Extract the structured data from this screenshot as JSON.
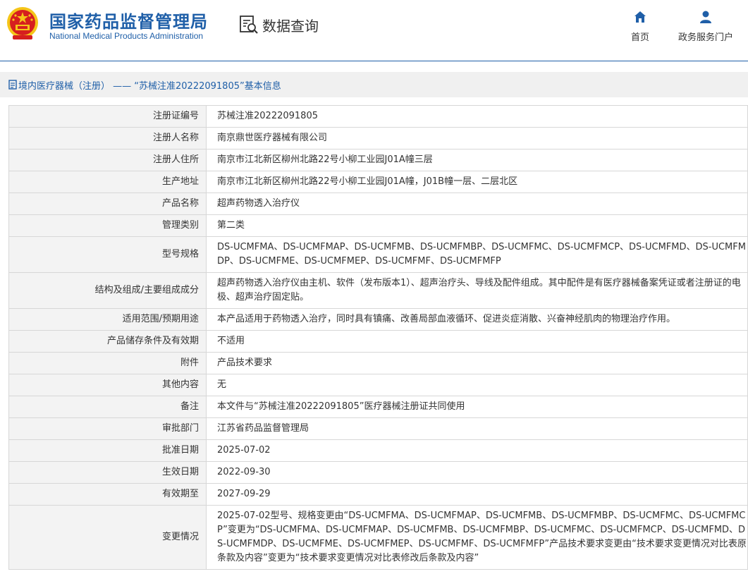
{
  "header": {
    "site_title_cn": "国家药品监督管理局",
    "site_title_en": "National Medical Products Administration",
    "query_label": "数据查询",
    "nav": {
      "home": "首页",
      "portal": "政务服务门户"
    }
  },
  "breadcrumb": "境内医疗器械（注册） —— “苏械注准20222091805”基本信息",
  "rows": [
    {
      "label": "注册证编号",
      "value": "苏械注准20222091805"
    },
    {
      "label": "注册人名称",
      "value": "南京鼎世医疗器械有限公司"
    },
    {
      "label": "注册人住所",
      "value": "南京市江北新区柳州北路22号小柳工业园J01A幢三层"
    },
    {
      "label": "生产地址",
      "value": "南京市江北新区柳州北路22号小柳工业园J01A幢，J01B幢一层、二层北区"
    },
    {
      "label": "产品名称",
      "value": "超声药物透入治疗仪"
    },
    {
      "label": "管理类别",
      "value": "第二类"
    },
    {
      "label": "型号规格",
      "value": "DS-UCMFMA、DS-UCMFMAP、DS-UCMFMB、DS-UCMFMBP、DS-UCMFMC、DS-UCMFMCP、DS-UCMFMD、DS-UCMFMDP、DS-UCMFME、DS-UCMFMEP、DS-UCMFMF、DS-UCMFMFP"
    },
    {
      "label": "结构及组成/主要组成成分",
      "value": "超声药物透入治疗仪由主机、软件（发布版本1）、超声治疗头、导线及配件组成。其中配件是有医疗器械备案凭证或者注册证的电极、超声治疗固定贴。"
    },
    {
      "label": "适用范围/预期用途",
      "value": "本产品适用于药物透入治疗，同时具有镇痛、改善局部血液循环、促进炎症消散、兴奋神经肌肉的物理治疗作用。"
    },
    {
      "label": "产品储存条件及有效期",
      "value": "不适用"
    },
    {
      "label": "附件",
      "value": "产品技术要求"
    },
    {
      "label": "其他内容",
      "value": "无"
    },
    {
      "label": "备注",
      "value": "本文件与“苏械注准20222091805”医疗器械注册证共同使用"
    },
    {
      "label": "审批部门",
      "value": "江苏省药品监督管理局"
    },
    {
      "label": "批准日期",
      "value": "2025-07-02"
    },
    {
      "label": "生效日期",
      "value": "2022-09-30"
    },
    {
      "label": "有效期至",
      "value": "2027-09-29"
    },
    {
      "label": "变更情况",
      "value": "2025-07-02型号、规格变更由“DS-UCMFMA、DS-UCMFMAP、DS-UCMFMB、DS-UCMFMBP、DS-UCMFMC、DS-UCMFMCP”变更为“DS-UCMFMA、DS-UCMFMAP、DS-UCMFMB、DS-UCMFMBP、DS-UCMFMC、DS-UCMFMCP、DS-UCMFMD、DS-UCMFMDP、DS-UCMFME、DS-UCMFMEP、DS-UCMFMF、DS-UCMFMFP”产品技术要求变更由“技术要求变更情况对比表原条款及内容”变更为“技术要求变更情况对比表修改后条款及内容”"
    }
  ],
  "colors": {
    "brand_blue": "#1f5fa8",
    "emblem_red": "#d61f1f",
    "emblem_gold": "#f5c518",
    "label_bg": "#f3f3f3",
    "breadcrumb_bg": "#f0f0f0"
  },
  "icons": {
    "emblem": "national-emblem-icon",
    "query": "data-query-icon",
    "home": "home-icon",
    "portal": "user-icon",
    "breadcrumb": "document-icon"
  }
}
